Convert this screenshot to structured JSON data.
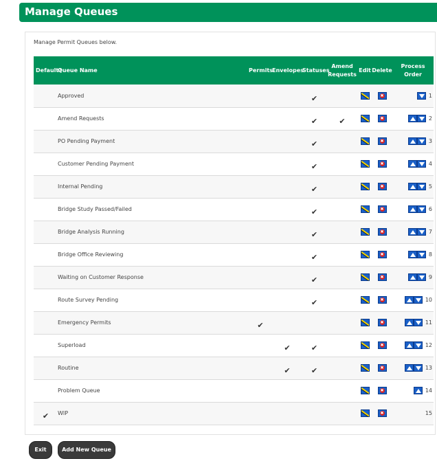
{
  "page": {
    "title": "Manage Queues",
    "intro": "Manage Permit Queues below."
  },
  "table": {
    "headers": {
      "default": "Default?",
      "name": "Queue Name",
      "permits": "Permits",
      "envelopes": "Envelopes",
      "statuses": "Statuses",
      "amend_line1": "Amend",
      "amend_line2": "Requests",
      "edit": "Edit",
      "delete": "Delete",
      "process_line1": "Process",
      "process_line2": "Order"
    },
    "rows": [
      {
        "name": "Approved",
        "default": false,
        "permits": false,
        "envelopes": false,
        "statuses": true,
        "amend": false,
        "up": false,
        "down": true,
        "order": "1"
      },
      {
        "name": "Amend Requests",
        "default": false,
        "permits": false,
        "envelopes": false,
        "statuses": true,
        "amend": true,
        "up": true,
        "down": true,
        "order": "2"
      },
      {
        "name": "PO Pending Payment",
        "default": false,
        "permits": false,
        "envelopes": false,
        "statuses": true,
        "amend": false,
        "up": true,
        "down": true,
        "order": "3"
      },
      {
        "name": "Customer Pending Payment",
        "default": false,
        "permits": false,
        "envelopes": false,
        "statuses": true,
        "amend": false,
        "up": true,
        "down": true,
        "order": "4"
      },
      {
        "name": "Internal Pending",
        "default": false,
        "permits": false,
        "envelopes": false,
        "statuses": true,
        "amend": false,
        "up": true,
        "down": true,
        "order": "5"
      },
      {
        "name": "Bridge Study Passed/Failed",
        "default": false,
        "permits": false,
        "envelopes": false,
        "statuses": true,
        "amend": false,
        "up": true,
        "down": true,
        "order": "6"
      },
      {
        "name": "Bridge Analysis Running",
        "default": false,
        "permits": false,
        "envelopes": false,
        "statuses": true,
        "amend": false,
        "up": true,
        "down": true,
        "order": "7"
      },
      {
        "name": "Bridge Office Reviewing",
        "default": false,
        "permits": false,
        "envelopes": false,
        "statuses": true,
        "amend": false,
        "up": true,
        "down": true,
        "order": "8"
      },
      {
        "name": "Waiting on Customer Response",
        "default": false,
        "permits": false,
        "envelopes": false,
        "statuses": true,
        "amend": false,
        "up": true,
        "down": true,
        "order": "9"
      },
      {
        "name": "Route Survey Pending",
        "default": false,
        "permits": false,
        "envelopes": false,
        "statuses": true,
        "amend": false,
        "up": true,
        "down": true,
        "order": "10"
      },
      {
        "name": "Emergency Permits",
        "default": false,
        "permits": true,
        "envelopes": false,
        "statuses": false,
        "amend": false,
        "up": true,
        "down": true,
        "order": "11"
      },
      {
        "name": "Superload",
        "default": false,
        "permits": false,
        "envelopes": true,
        "statuses": true,
        "amend": false,
        "up": true,
        "down": true,
        "order": "12"
      },
      {
        "name": "Routine",
        "default": false,
        "permits": false,
        "envelopes": true,
        "statuses": true,
        "amend": false,
        "up": true,
        "down": true,
        "order": "13"
      },
      {
        "name": "Problem Queue",
        "default": false,
        "permits": false,
        "envelopes": false,
        "statuses": false,
        "amend": false,
        "up": true,
        "down": false,
        "order": "14"
      },
      {
        "name": "WIP",
        "default": true,
        "permits": false,
        "envelopes": false,
        "statuses": false,
        "amend": false,
        "up": false,
        "down": false,
        "order": "15"
      }
    ],
    "check_glyph": "✔",
    "delete_glyph": "✖"
  },
  "buttons": {
    "exit": "Exit",
    "add": "Add New Queue"
  },
  "icons": {
    "edit": "edit-pencil-icon",
    "delete": "delete-x-icon",
    "move_up": "arrow-up-icon",
    "move_down": "arrow-down-icon",
    "check": "checkmark-icon"
  },
  "colors": {
    "header_green": "#00925a",
    "icon_blue": "#1a60c8",
    "delete_red": "#d81e1e",
    "button_dark": "#3a3a3a"
  }
}
